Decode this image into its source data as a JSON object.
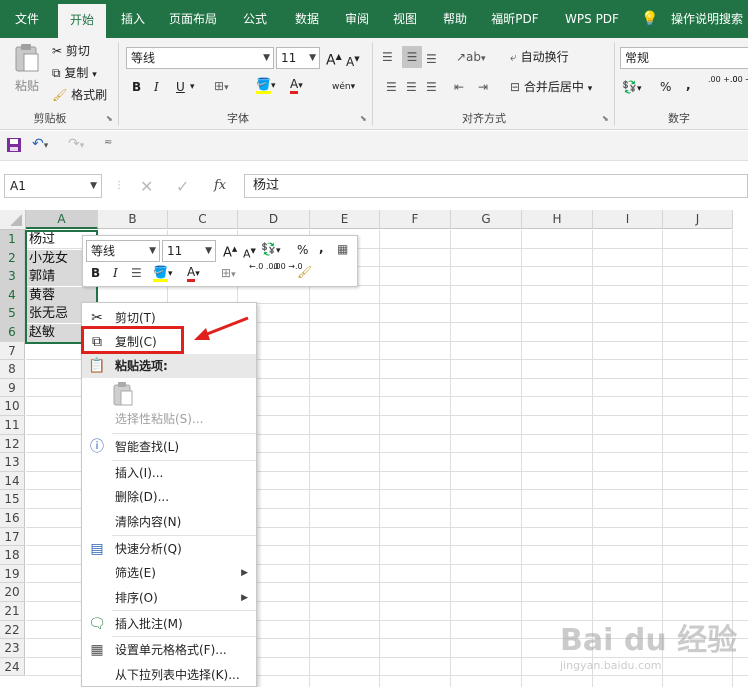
{
  "tabs": [
    {
      "label": "文件",
      "active": false
    },
    {
      "label": "开始",
      "active": true
    },
    {
      "label": "插入",
      "active": false
    },
    {
      "label": "页面布局",
      "active": false
    },
    {
      "label": "公式",
      "active": false
    },
    {
      "label": "数据",
      "active": false
    },
    {
      "label": "审阅",
      "active": false
    },
    {
      "label": "视图",
      "active": false
    },
    {
      "label": "帮助",
      "active": false
    },
    {
      "label": "福昕PDF",
      "active": false
    },
    {
      "label": "WPS PDF",
      "active": false
    },
    {
      "label": "操作说明搜索",
      "active": false
    }
  ],
  "ribbon": {
    "clipboard": {
      "label": "剪贴板",
      "paste": "粘贴",
      "cut": "剪切",
      "copy": "复制",
      "format_painter": "格式刷"
    },
    "font": {
      "label": "字体",
      "font_name": "等线",
      "font_size": "11",
      "bold": "B",
      "italic": "I",
      "underline": "U",
      "grow": "A",
      "shrink": "A",
      "phonetic": "wén",
      "font_color_letter": "A"
    },
    "alignment": {
      "label": "对齐方式",
      "wrap": "自动换行",
      "merge": "合并后居中"
    },
    "number": {
      "label": "数字",
      "format": "常规",
      "percent": "%",
      "comma": ",",
      "inc_decimal": ".00 +.0",
      "dec_decimal": ".00 →.0"
    }
  },
  "formula_bar": {
    "name_box": "A1",
    "fx": "fx",
    "value": "杨过"
  },
  "columns": [
    "A",
    "B",
    "C",
    "D",
    "E",
    "F",
    "G",
    "H",
    "I",
    "J"
  ],
  "rows": [
    "1",
    "2",
    "3",
    "4",
    "5",
    "6",
    "7",
    "8",
    "9",
    "10",
    "11",
    "12",
    "13",
    "14",
    "15",
    "16",
    "17",
    "18",
    "19",
    "20",
    "21",
    "22",
    "23",
    "24"
  ],
  "cells_a": [
    "杨过",
    "小龙女",
    "郭靖",
    "黄蓉",
    "张无忌",
    "赵敏"
  ],
  "mini_toolbar": {
    "font_name": "等线",
    "font_size": "11",
    "grow": "A",
    "shrink": "A",
    "percent": "%",
    "comma": ",",
    "bold": "B",
    "italic": "I",
    "font_color_letter": "A",
    "inc_decimal": "←.0 .00",
    "dec_decimal": ".00 →.0"
  },
  "context_menu": {
    "cut": "剪切(T)",
    "copy": "复制(C)",
    "paste_options": "粘贴选项:",
    "paste_special": "选择性粘贴(S)...",
    "smart_lookup": "智能查找(L)",
    "insert": "插入(I)...",
    "delete": "删除(D)...",
    "clear": "清除内容(N)",
    "quick_analysis": "快速分析(Q)",
    "filter": "筛选(E)",
    "sort": "排序(O)",
    "insert_comment": "插入批注(M)",
    "format_cells": "设置单元格格式(F)...",
    "pick_list": "从下拉列表中选择(K)..."
  },
  "watermark": {
    "line1": "Bai du 经验",
    "line2": "jingyan.baidu.com"
  },
  "colors": {
    "accent": "#217346",
    "highlight_box": "#e0201c",
    "selection_gray": "#d9d9d9"
  }
}
